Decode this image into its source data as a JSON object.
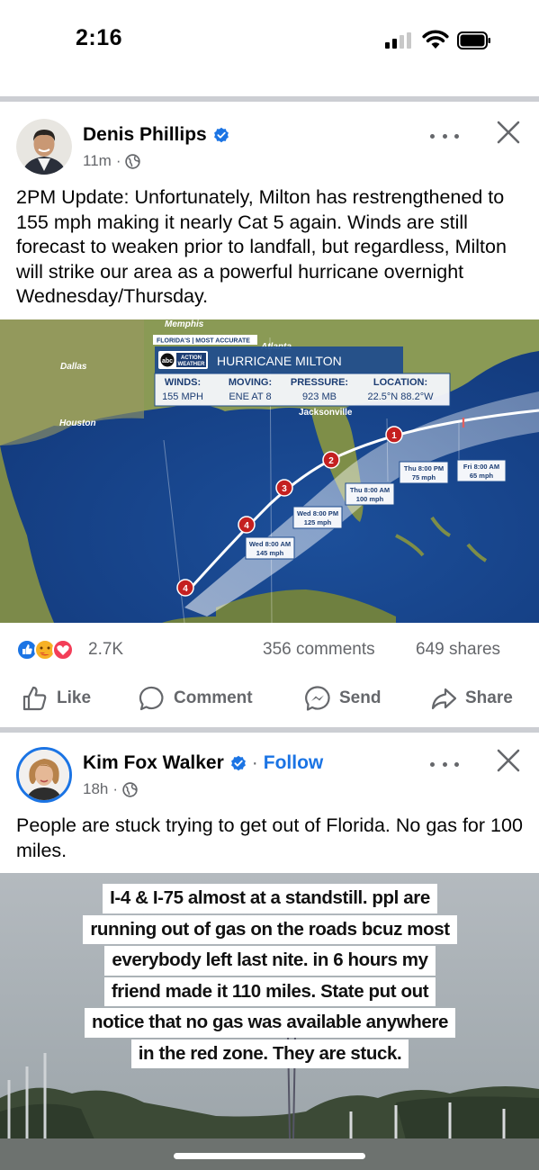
{
  "status_bar": {
    "time": "2:16"
  },
  "posts": [
    {
      "author": "Denis Phillips",
      "time_ago": "11m",
      "meta_sep": "·",
      "text": "2PM Update: Unfortunately, Milton has restrengthened to 155 mph making it nearly Cat 5 again. Winds are still forecast to weaken prior to landfall, but regardless,  Milton will strike our area as a powerful hurricane overnight Wednesday/Thursday.",
      "map": {
        "cities": [
          "Memphis",
          "Atlanta",
          "Dallas",
          "Houston",
          "Jacksonville"
        ],
        "tag": "FLORIDA'S | MOST ACCURATE",
        "logo_abc": "abc",
        "logo_action": "ACTION",
        "logo_weather": "WEATHER",
        "banner_title": "HURRICANE MILTON",
        "stats": [
          {
            "label": "WINDS:",
            "value": "155 MPH"
          },
          {
            "label": "MOVING:",
            "value": "ENE AT 8"
          },
          {
            "label": "PRESSURE:",
            "value": "923 MB"
          },
          {
            "label": "LOCATION:",
            "value": "22.5°N  88.2°W"
          }
        ],
        "forecast_points": [
          {
            "category": "4",
            "time": "",
            "wind": ""
          },
          {
            "category": "4",
            "time": "Wed 8:00 AM",
            "wind": "145 mph"
          },
          {
            "category": "3",
            "time": "Wed 8:00 PM",
            "wind": "125 mph"
          },
          {
            "category": "2",
            "time": "Thu 8:00 AM",
            "wind": "100 mph"
          },
          {
            "category": "1",
            "time": "Thu 8:00 PM",
            "wind": "75 mph"
          },
          {
            "category": "",
            "time": "Fri 8:00 AM",
            "wind": "65 mph"
          }
        ]
      },
      "reactions_count": "2.7K",
      "comments": "356 comments",
      "shares": "649 shares",
      "actions": [
        "Like",
        "Comment",
        "Send",
        "Share"
      ]
    },
    {
      "author": "Kim Fox Walker",
      "follow_sep": "·",
      "follow": "Follow",
      "time_ago": "18h",
      "meta_sep": "·",
      "text": "People are stuck trying to get out of Florida. No gas for 100 miles.",
      "overlay_lines": [
        "I-4 & I-75 almost at a standstill. ppl are",
        "running out of gas on the roads bcuz most",
        "everybody left last nite. in 6 hours my",
        "friend made it 110 miles. State put out",
        "notice that no gas was available anywhere",
        "in the red zone. They are stuck."
      ]
    }
  ],
  "colors": {
    "facebook_blue": "#1b74e4",
    "secondary_text": "#65676b",
    "divider": "#ccced3"
  }
}
